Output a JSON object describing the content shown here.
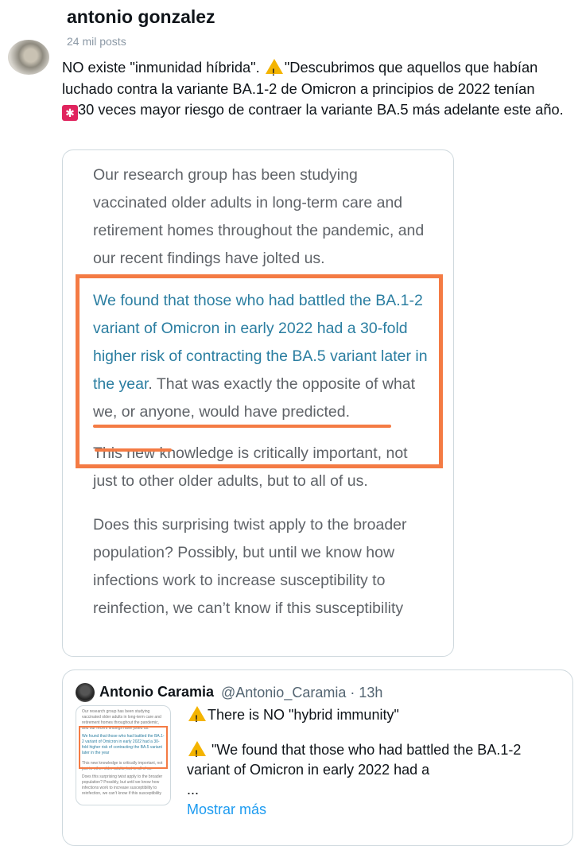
{
  "post": {
    "author_name": "antonio gonzalez",
    "post_count": "24 mil posts",
    "text_part1": "NO existe \"inmunidad híbrida\". ",
    "text_part2": "\"Descubrimos que aquellos que habían luchado contra la variante BA.1-2 de Omicron a principios de 2022 tenían ",
    "text_part3": "30 veces mayor riesgo de contraer la variante BA.5 más adelante este año."
  },
  "article_image": {
    "para1": "Our research group has been studying vaccinated older adults in long-term care and retirement homes throughout the pandemic, and our recent findings have jolted us.",
    "para2_highlight": "We found that those who had battled the BA.1-2 variant of Omicron in early 2022 had a 30-fold higher risk of contracting the BA.5 variant later in the year",
    "para2_rest": ". That was exactly the opposite of what we, or anyone, would have predicted.",
    "para3": "This new knowledge is critically important, not just to other older adults, but to all of us.",
    "para4": "Does this surprising twist apply to the broader population? Possibly, but until we know how infections work to increase susceptibility to reinfection, we can’t know if this susceptibility"
  },
  "quoted_tweet": {
    "name": "Antonio Caramia",
    "handle_time": "@Antonio_Caramia · 13h",
    "line1": "There is NO \"hybrid immunity\"",
    "line2": "\"We found that those who had battled the BA.1-2 variant of Omicron in early 2022 had a",
    "ellipsis": "...",
    "show_more": "Mostrar más"
  },
  "colors": {
    "highlight_orange": "#f47b44",
    "article_blue": "#2b7ea1",
    "link_blue": "#1d9bf0"
  },
  "icons": [
    "warning-emoji-icon",
    "siren-emoji-icon"
  ]
}
